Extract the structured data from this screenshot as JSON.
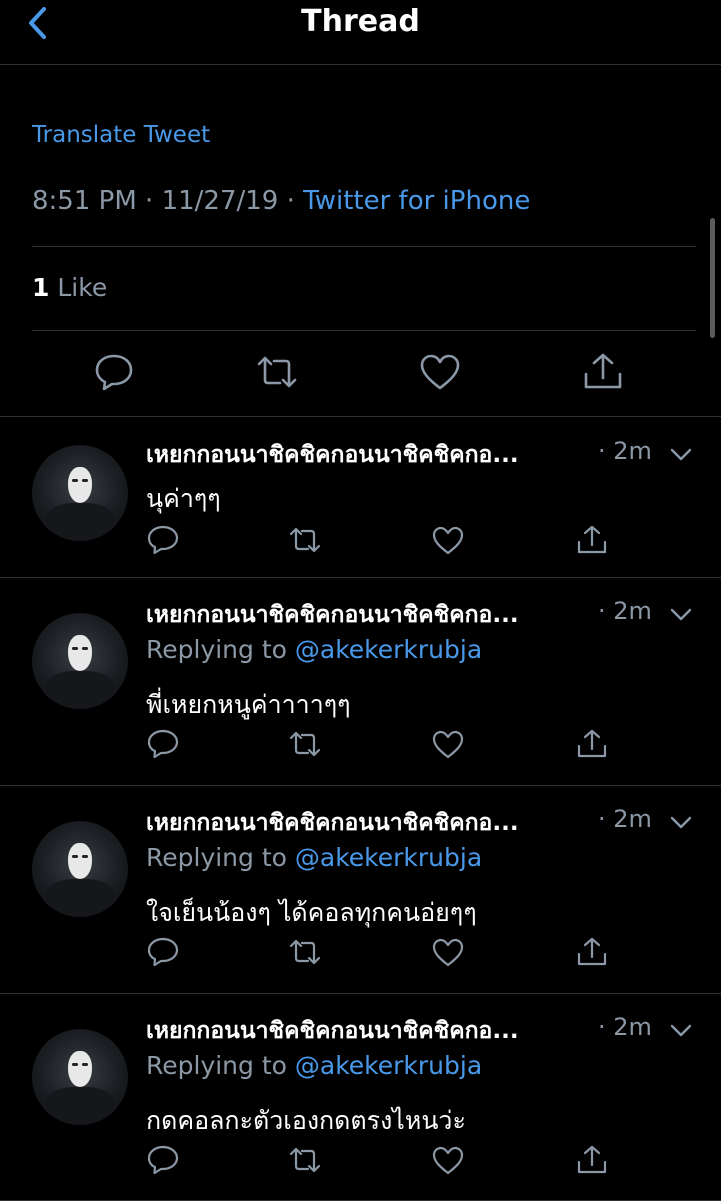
{
  "header": {
    "title": "Thread"
  },
  "tweet": {
    "translate_label": "Translate Tweet",
    "time": "8:51 PM",
    "sep1": " · ",
    "date": "11/27/19",
    "sep2": " · ",
    "source": "Twitter for iPhone",
    "likes_count": "1",
    "likes_label": " Like"
  },
  "replies": [
    {
      "name": "เหยกกอนนาชิคชิคกอนนาชิคชิคกอ...",
      "time": "· 2m",
      "replying_prefix": "",
      "replying_handle": "",
      "text": "นุค่าๆๆ"
    },
    {
      "name": "เหยกกอนนาชิคชิคกอนนาชิคชิคกอ...",
      "time": "· 2m",
      "replying_prefix": "Replying to ",
      "replying_handle": "@akekerkrubja",
      "text": "พี่เหยกหนูค่าาาาๆๆ"
    },
    {
      "name": "เหยกกอนนาชิคชิคกอนนาชิคชิคกอ...",
      "time": "· 2m",
      "replying_prefix": "Replying to ",
      "replying_handle": "@akekerkrubja",
      "text": "ใจเย็นน้องๆ ได้คอลทุกคนอ่ยๆๆ"
    },
    {
      "name": "เหยกกอนนาชิคชิคกอนนาชิคชิคกอ...",
      "time": "· 2m",
      "replying_prefix": "Replying to ",
      "replying_handle": "@akekerkrubja",
      "text": "กดคอลกะตัวเองกดตรงไหนว่ะ"
    }
  ],
  "colors": {
    "accent": "#4a99e9",
    "muted": "#8b98a5",
    "background": "#000000",
    "divider": "#2f3336"
  },
  "icons": [
    "back-chevron-icon",
    "reply-icon",
    "retweet-icon",
    "like-icon",
    "share-icon",
    "chevron-down-icon"
  ]
}
